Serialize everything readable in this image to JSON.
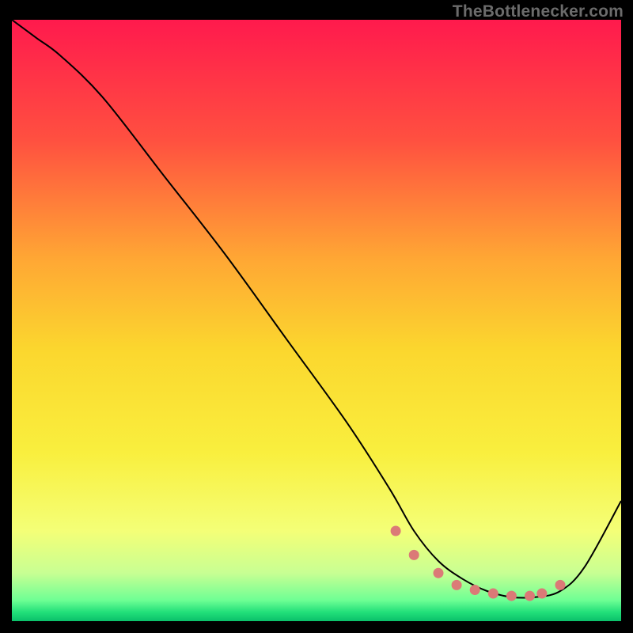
{
  "watermark": "TheBottlenecker.com",
  "chart_data": {
    "type": "line",
    "title": "",
    "xlabel": "",
    "ylabel": "",
    "xlim": [
      0,
      100
    ],
    "ylim": [
      0,
      100
    ],
    "series": [
      {
        "name": "curve",
        "color": "#000000",
        "x": [
          0,
          4,
          8,
          15,
          25,
          35,
          45,
          55,
          62,
          66,
          70,
          74,
          78,
          82,
          86,
          90,
          94,
          100
        ],
        "y": [
          100,
          97,
          94,
          87,
          74,
          61,
          47,
          33,
          22,
          15,
          10,
          7,
          5,
          4,
          4,
          5,
          9,
          20
        ]
      }
    ],
    "markers": {
      "name": "highlight-dots",
      "color": "#db7a77",
      "x": [
        63,
        66,
        70,
        73,
        76,
        79,
        82,
        85,
        87,
        90
      ],
      "y": [
        15,
        11,
        8,
        6,
        5.2,
        4.6,
        4.2,
        4.2,
        4.6,
        6
      ]
    },
    "background": {
      "type": "vertical-gradient",
      "stops": [
        {
          "offset": 0.0,
          "color": "#ff1a4d"
        },
        {
          "offset": 0.2,
          "color": "#ff5040"
        },
        {
          "offset": 0.4,
          "color": "#ffa834"
        },
        {
          "offset": 0.55,
          "color": "#fbd72e"
        },
        {
          "offset": 0.72,
          "color": "#f9ef3e"
        },
        {
          "offset": 0.85,
          "color": "#f4ff77"
        },
        {
          "offset": 0.92,
          "color": "#c8ff93"
        },
        {
          "offset": 0.965,
          "color": "#6fff94"
        },
        {
          "offset": 0.985,
          "color": "#22e07a"
        },
        {
          "offset": 1.0,
          "color": "#0ac06a"
        }
      ]
    }
  }
}
